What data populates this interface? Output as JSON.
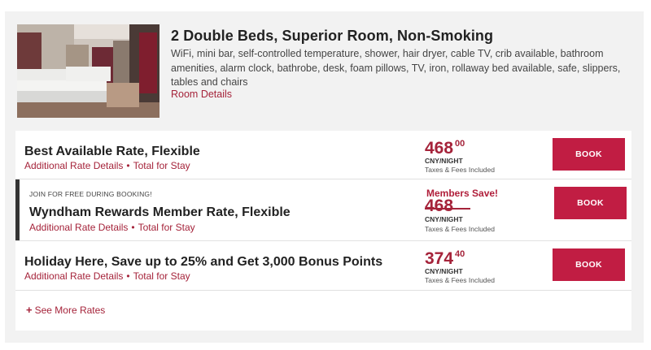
{
  "room": {
    "title": "2 Double Beds, Superior Room, Non-Smoking",
    "amenities": "WiFi, mini bar, self-controlled temperature, shower, hair dryer, cable TV, crib available, bathroom amenities, alarm clock, bathrobe, desk, foam pillows, TV, iron, rollaway bed available, safe, slippers, tables and chairs",
    "details_link": "Room Details"
  },
  "rates": [
    {
      "name": "Best Available Rate, Flexible",
      "rate_details_link": "Additional Rate Details",
      "total_link": "Total for Stay",
      "price_whole": "468",
      "price_cents": "00",
      "unit": "CNY/NIGHT",
      "taxes": "Taxes & Fees Included",
      "book_label": "BOOK"
    },
    {
      "join_note": "JOIN FOR FREE DURING BOOKING!",
      "name": "Wyndham Rewards Member Rate, Flexible",
      "rate_details_link": "Additional Rate Details",
      "total_link": "Total for Stay",
      "members_save": "Members Save!",
      "struck_price": "468",
      "unit": "CNY/NIGHT",
      "taxes": "Taxes & Fees Included",
      "book_label": "BOOK"
    },
    {
      "name": "Holiday Here, Save up to 25% and Get 3,000 Bonus Points",
      "rate_details_link": "Additional Rate Details",
      "total_link": "Total for Stay",
      "price_whole": "374",
      "price_cents": "40",
      "unit": "CNY/NIGHT",
      "taxes": "Taxes & Fees Included",
      "book_label": "BOOK"
    }
  ],
  "see_more": {
    "icon": "plus-icon",
    "label": "See More Rates"
  },
  "colors": {
    "accent": "#a5233a",
    "book_button": "#c11d43",
    "panel_bg": "#f2f2f2"
  }
}
